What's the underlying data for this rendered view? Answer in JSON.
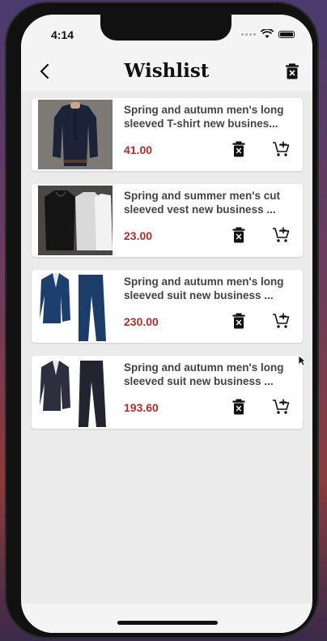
{
  "status_bar": {
    "time": "4:14"
  },
  "header": {
    "title": "Wishlist"
  },
  "items": [
    {
      "name": "Spring and autumn men's long sleeved T-shirt new busines...",
      "price": "41.00",
      "image": "navy-long-sleeve-shirt"
    },
    {
      "name": "Spring and summer men's cut sleeved vest new business ...",
      "price": "23.00",
      "image": "black-grey-white-vests"
    },
    {
      "name": "Spring and autumn men's long sleeved suit new business ...",
      "price": "230.00",
      "image": "navy-blue-suit"
    },
    {
      "name": "Spring and autumn men's long sleeved suit new business ...",
      "price": "193.60",
      "image": "dark-grey-suit"
    }
  ],
  "colors": {
    "price": "#b52b26",
    "background": "#ebebeb",
    "card": "#ffffff"
  }
}
